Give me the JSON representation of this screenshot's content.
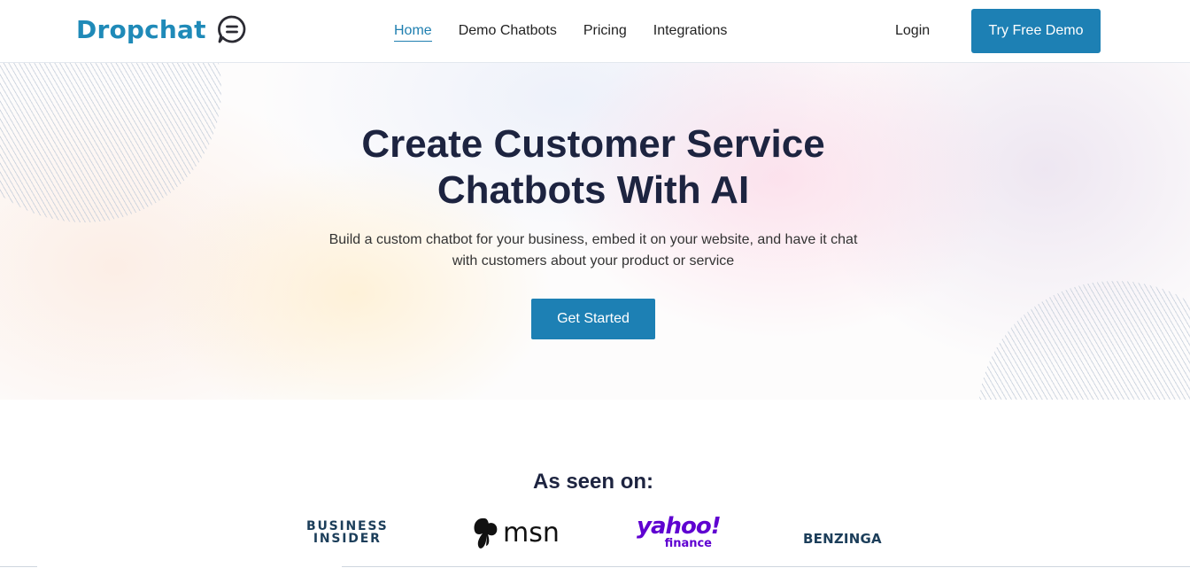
{
  "header": {
    "logo_text": "Dropchat",
    "logo_icon": "chat-bubble-icon",
    "nav": [
      {
        "label": "Home",
        "active": true
      },
      {
        "label": "Demo Chatbots",
        "active": false
      },
      {
        "label": "Pricing",
        "active": false
      },
      {
        "label": "Integrations",
        "active": false
      }
    ],
    "login_label": "Login",
    "cta_label": "Try Free Demo"
  },
  "hero": {
    "title_line1": "Create Customer Service",
    "title_line2": "Chatbots With AI",
    "subtitle": "Build a custom chatbot for your business, embed it on your website, and have it chat with customers about your product or service",
    "cta_label": "Get Started"
  },
  "press": {
    "title": "As seen on:",
    "logos": {
      "business_insider_line1": "BUSINESS",
      "business_insider_line2": "INSIDER",
      "msn": "msn",
      "yahoo": "yahoo!",
      "yahoo_sub": "finance",
      "benzinga": "BENZINGA"
    }
  },
  "colors": {
    "brand": "#1f8ab8",
    "button": "#1d80b4",
    "heading": "#1d2440",
    "yahoo": "#5f01d1"
  }
}
